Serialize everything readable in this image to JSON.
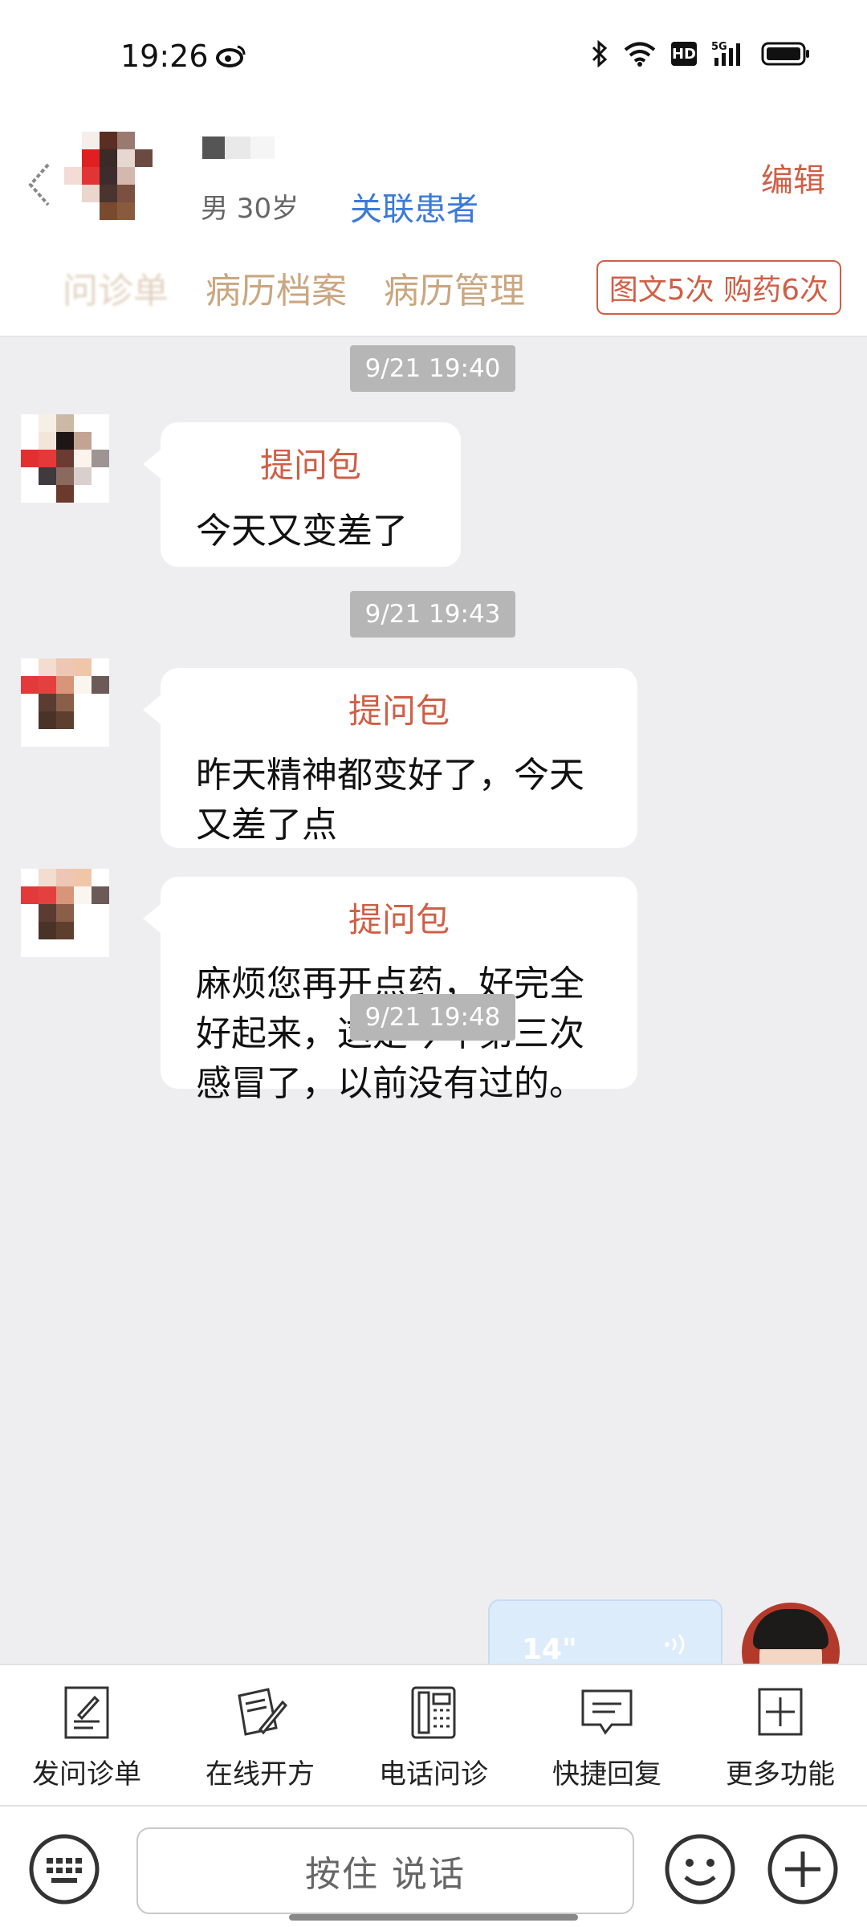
{
  "status_bar": {
    "time": "19:26",
    "icons": [
      "weibo-icon",
      "bluetooth-icon",
      "wifi-icon",
      "hd-icon",
      "signal-5g-icon",
      "battery-icon"
    ],
    "hd_label": "HD",
    "net_label": "5G"
  },
  "header": {
    "gender_age": "男 30岁",
    "link_patient": "关联患者",
    "edit": "编辑",
    "tabs": [
      "问诊单",
      "病历档案",
      "病历管理"
    ],
    "quota": "图文5次 购药6次"
  },
  "messages": [
    {
      "time": "9/21 19:40",
      "title": "提问包",
      "text": "今天又变差了"
    },
    {
      "time": "9/21 19:43",
      "title": "提问包",
      "text": "昨天精神都变好了，今天又差了点"
    },
    {
      "title": "提问包",
      "text": "麻烦您再开点药，好完全好起来，这是今年第三次感冒了，以前没有过的。"
    },
    {
      "time": "9/21 19:48",
      "voice_duration": "14\""
    }
  ],
  "functions": [
    {
      "label": "发问诊单",
      "icon": "form-icon"
    },
    {
      "label": "在线开方",
      "icon": "prescription-icon"
    },
    {
      "label": "电话问诊",
      "icon": "phone-icon"
    },
    {
      "label": "快捷回复",
      "icon": "quick-reply-icon"
    },
    {
      "label": "更多功能",
      "icon": "more-icon"
    }
  ],
  "input": {
    "voice_button": "按住 说话"
  },
  "colors": {
    "accent": "#cf5f46",
    "link": "#3c7ad6",
    "tab": "#caa780",
    "background": "#eeeef1"
  }
}
